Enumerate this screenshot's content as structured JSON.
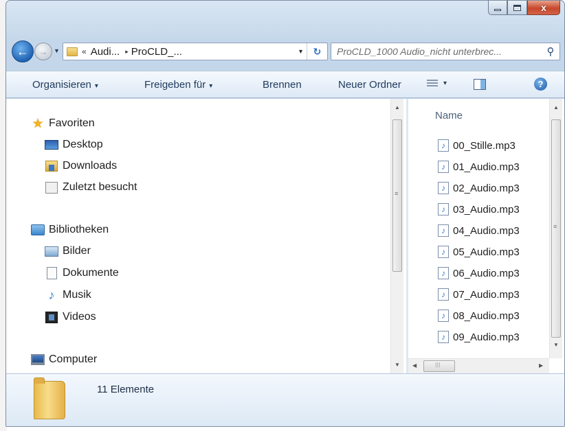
{
  "window": {
    "caption_buttons": {
      "minimize": "minimize-icon",
      "maximize": "maximize-icon",
      "close": "close-icon",
      "close_glyph": "x"
    }
  },
  "address_bar": {
    "overflow_marker": "«",
    "crumbs": [
      "Audi...",
      "ProCLD_..."
    ],
    "separator": "▸",
    "dropdown_glyph": "▾",
    "refresh_glyph": "↻"
  },
  "search": {
    "placeholder": "ProCLD_1000 Audio_nicht unterbrec..."
  },
  "toolbar": {
    "organize": "Organisieren",
    "share": "Freigeben für",
    "burn": "Brennen",
    "new_folder": "Neuer Ordner",
    "caret": "▾",
    "help_glyph": "?"
  },
  "navigation": {
    "favorites": {
      "label": "Favoriten",
      "items": [
        "Desktop",
        "Downloads",
        "Zuletzt besucht"
      ]
    },
    "libraries": {
      "label": "Bibliotheken",
      "items": [
        "Bilder",
        "Dokumente",
        "Musik",
        "Videos"
      ]
    },
    "computer": {
      "label": "Computer"
    }
  },
  "content": {
    "column_header": "Name",
    "files": [
      "00_Stille.mp3",
      "01_Audio.mp3",
      "02_Audio.mp3",
      "03_Audio.mp3",
      "04_Audio.mp3",
      "05_Audio.mp3",
      "06_Audio.mp3",
      "07_Audio.mp3",
      "08_Audio.mp3",
      "09_Audio.mp3"
    ]
  },
  "details": {
    "count": "11 Elemente"
  },
  "colors": {
    "frame": "#c4d7ea",
    "toolbar_text": "#1e395b",
    "close_button": "#c7482b",
    "link_blue": "#2e7cd6"
  }
}
